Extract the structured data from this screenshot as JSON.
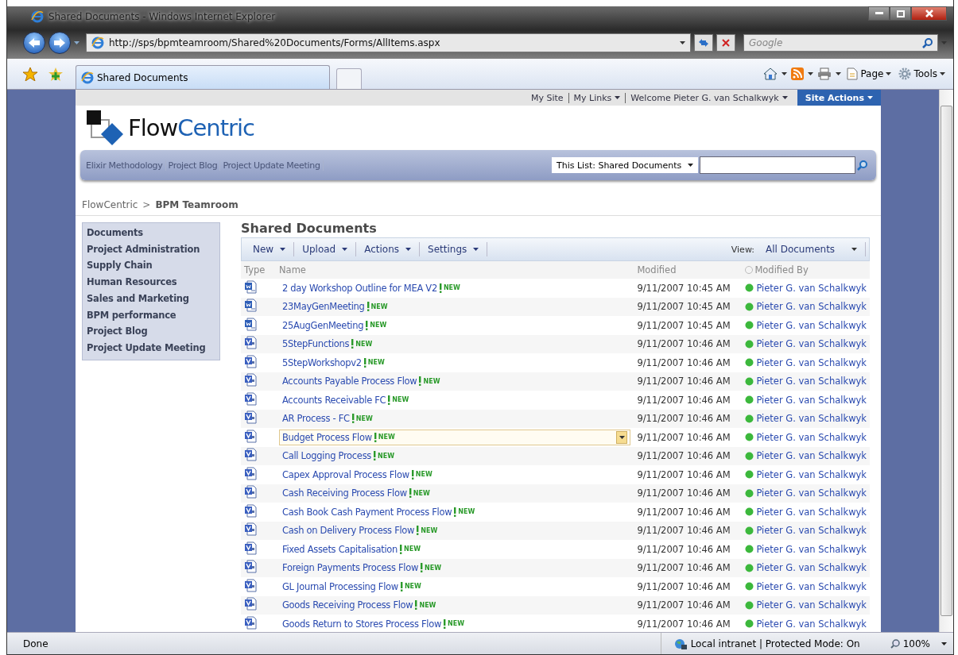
{
  "window": {
    "title": "Shared Documents - Windows Internet Explorer"
  },
  "address_bar": {
    "url": "http://sps/bpmteamroom/Shared%20Documents/Forms/AllItems.aspx"
  },
  "search_box": {
    "placeholder": "Google"
  },
  "tabs": [
    {
      "label": "Shared Documents",
      "selected": true
    }
  ],
  "command_bar": {
    "page": "Page",
    "tools": "Tools"
  },
  "top_links": [
    "My Site",
    "My Links",
    "Welcome Pieter G. van Schalkwyk"
  ],
  "site_actions": "Site Actions",
  "logo": {
    "dark_part": "Flow",
    "blue_part": "Centric"
  },
  "top_nav": [
    "Elixir Methodology",
    "Project Blog",
    "Project Update Meeting"
  ],
  "site_search": {
    "scope": "This List: Shared Documents"
  },
  "breadcrumb": {
    "parent": "FlowCentric",
    "separator": ">",
    "current": "BPM Teamroom"
  },
  "quick_launch": [
    "Documents",
    "Project Administration",
    "Supply Chain",
    "Human Resources",
    "Sales and Marketing",
    "BPM performance",
    "Project Blog",
    "Project Update Meeting"
  ],
  "list": {
    "title": "Shared Documents",
    "toolbar": [
      "New",
      "Upload",
      "Actions",
      "Settings"
    ],
    "view_label": "View:",
    "view": "All Documents",
    "columns": [
      "Type",
      "Name",
      "Modified",
      "Modified By"
    ],
    "rows": [
      {
        "kind": "word",
        "name": "2 day Workshop Outline for MEA V2",
        "badge": "NEW",
        "modified": "9/11/2007 10:45 AM",
        "modified_by": "Pieter G. van Schalkwyk",
        "selected": false
      },
      {
        "kind": "word",
        "name": "23MayGenMeeting",
        "badge": "NEW",
        "modified": "9/11/2007 10:45 AM",
        "modified_by": "Pieter G. van Schalkwyk",
        "selected": false
      },
      {
        "kind": "word",
        "name": "25AugGenMeeting",
        "badge": "NEW",
        "modified": "9/11/2007 10:45 AM",
        "modified_by": "Pieter G. van Schalkwyk",
        "selected": false
      },
      {
        "kind": "visio",
        "name": "5StepFunctions",
        "badge": "NEW",
        "modified": "9/11/2007 10:46 AM",
        "modified_by": "Pieter G. van Schalkwyk",
        "selected": false
      },
      {
        "kind": "visio",
        "name": "5StepWorkshopv2",
        "badge": "NEW",
        "modified": "9/11/2007 10:46 AM",
        "modified_by": "Pieter G. van Schalkwyk",
        "selected": false
      },
      {
        "kind": "visio",
        "name": "Accounts Payable Process Flow",
        "badge": "NEW",
        "modified": "9/11/2007 10:46 AM",
        "modified_by": "Pieter G. van Schalkwyk",
        "selected": false
      },
      {
        "kind": "visio",
        "name": "Accounts Receivable FC",
        "badge": "NEW",
        "modified": "9/11/2007 10:46 AM",
        "modified_by": "Pieter G. van Schalkwyk",
        "selected": false
      },
      {
        "kind": "visio",
        "name": "AR Process - FC",
        "badge": "NEW",
        "modified": "9/11/2007 10:46 AM",
        "modified_by": "Pieter G. van Schalkwyk",
        "selected": false
      },
      {
        "kind": "visio",
        "name": "Budget Process Flow",
        "badge": "NEW",
        "modified": "9/11/2007 10:46 AM",
        "modified_by": "Pieter G. van Schalkwyk",
        "selected": true
      },
      {
        "kind": "visio",
        "name": "Call Logging Process",
        "badge": "NEW",
        "modified": "9/11/2007 10:46 AM",
        "modified_by": "Pieter G. van Schalkwyk",
        "selected": false
      },
      {
        "kind": "visio",
        "name": "Capex Approval Process Flow",
        "badge": "NEW",
        "modified": "9/11/2007 10:46 AM",
        "modified_by": "Pieter G. van Schalkwyk",
        "selected": false
      },
      {
        "kind": "visio",
        "name": "Cash Receiving Process Flow",
        "badge": "NEW",
        "modified": "9/11/2007 10:46 AM",
        "modified_by": "Pieter G. van Schalkwyk",
        "selected": false
      },
      {
        "kind": "visio",
        "name": "Cash Book Cash Payment Process Flow",
        "badge": "NEW",
        "modified": "9/11/2007 10:46 AM",
        "modified_by": "Pieter G. van Schalkwyk",
        "selected": false
      },
      {
        "kind": "visio",
        "name": "Cash on Delivery Process Flow",
        "badge": "NEW",
        "modified": "9/11/2007 10:46 AM",
        "modified_by": "Pieter G. van Schalkwyk",
        "selected": false
      },
      {
        "kind": "visio",
        "name": "Fixed Assets Capitalisation",
        "badge": "NEW",
        "modified": "9/11/2007 10:46 AM",
        "modified_by": "Pieter G. van Schalkwyk",
        "selected": false
      },
      {
        "kind": "visio",
        "name": "Foreign Payments Process Flow",
        "badge": "NEW",
        "modified": "9/11/2007 10:46 AM",
        "modified_by": "Pieter G. van Schalkwyk",
        "selected": false
      },
      {
        "kind": "visio",
        "name": "GL Journal Processing Flow",
        "badge": "NEW",
        "modified": "9/11/2007 10:46 AM",
        "modified_by": "Pieter G. van Schalkwyk",
        "selected": false
      },
      {
        "kind": "visio",
        "name": "Goods Receiving Process Flow",
        "badge": "NEW",
        "modified": "9/11/2007 10:46 AM",
        "modified_by": "Pieter G. van Schalkwyk",
        "selected": false
      },
      {
        "kind": "visio",
        "name": "Goods Return to Stores Process Flow",
        "badge": "NEW",
        "modified": "9/11/2007 10:46 AM",
        "modified_by": "Pieter G. van Schalkwyk",
        "selected": false
      }
    ]
  },
  "status_bar": {
    "text": "Done",
    "zone": "Local intranet | Protected Mode: On",
    "zoom": "100%"
  }
}
